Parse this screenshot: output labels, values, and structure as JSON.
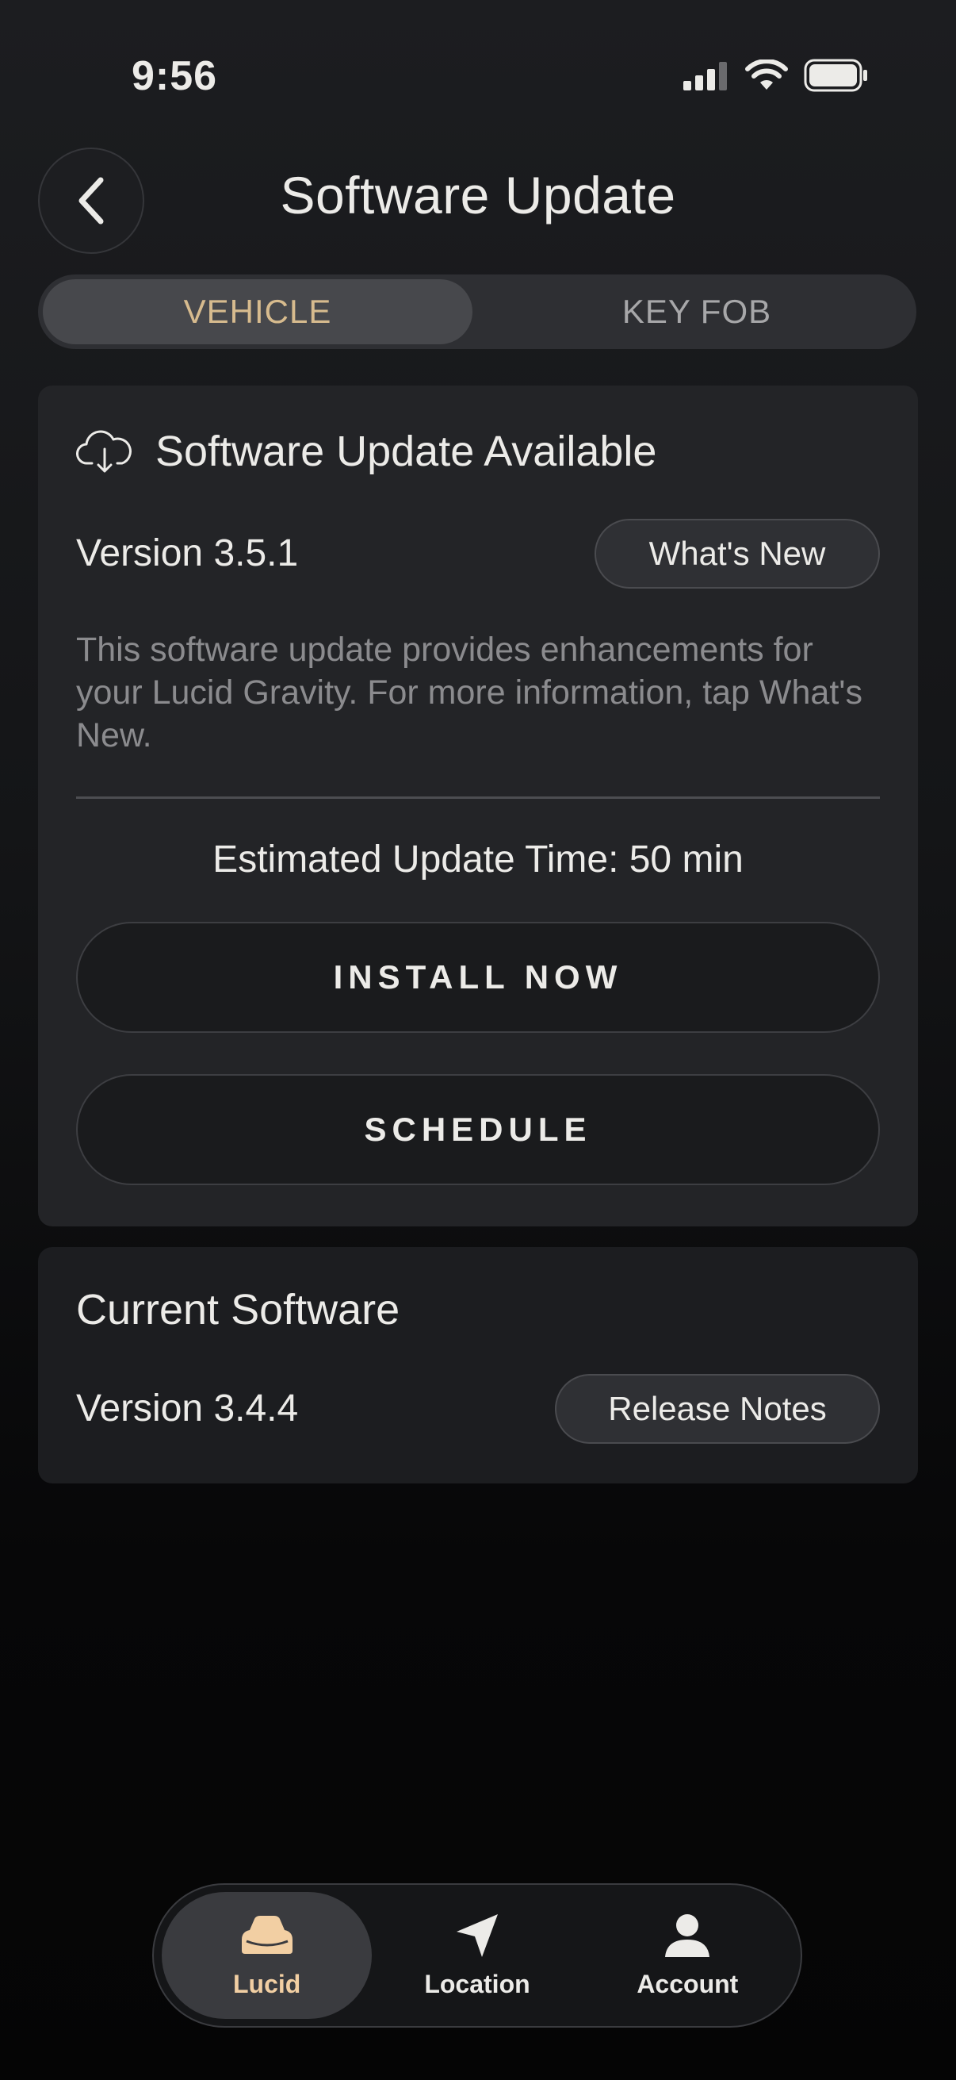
{
  "status_bar": {
    "time": "9:56",
    "icons": [
      "signal-icon",
      "wifi-icon",
      "battery-icon"
    ]
  },
  "header": {
    "title": "Software Update",
    "back_icon": "chevron-left-icon"
  },
  "tabs": [
    {
      "label": "VEHICLE",
      "active": true
    },
    {
      "label": "KEY FOB",
      "active": false
    }
  ],
  "update_card": {
    "icon": "cloud-download-icon",
    "title": "Software Update Available",
    "version": "Version 3.5.1",
    "whats_new_label": "What's New",
    "description": "This software update provides enhancements for your Lucid Gravity. For more information, tap What's New.",
    "estimate": "Estimated Update Time: 50 min",
    "install_label": "INSTALL NOW",
    "schedule_label": "SCHEDULE"
  },
  "current_card": {
    "title": "Current Software",
    "version": "Version 3.4.4",
    "release_notes_label": "Release Notes"
  },
  "bottom_nav": [
    {
      "label": "Lucid",
      "icon": "car-icon",
      "active": true
    },
    {
      "label": "Location",
      "icon": "navigation-arrow-icon",
      "active": false
    },
    {
      "label": "Account",
      "icon": "person-icon",
      "active": false
    }
  ],
  "colors": {
    "accent": "#d7bb8e",
    "nav_active": "#f2cfa3"
  }
}
